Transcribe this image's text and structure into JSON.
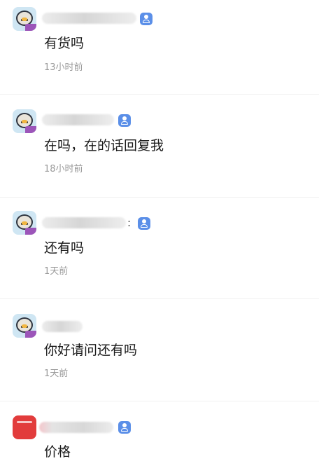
{
  "comments": [
    {
      "message": "有货吗",
      "time": "13小时前",
      "avatar_icon": "penguin-avatar",
      "verified_icon": "verified-user-icon"
    },
    {
      "message": "在吗，在的话回复我",
      "time": "18小时前",
      "avatar_icon": "penguin-avatar",
      "verified_icon": "verified-user-icon"
    },
    {
      "message": "还有吗",
      "time": "1天前",
      "avatar_icon": "penguin-avatar",
      "verified_icon": "verified-user-icon"
    },
    {
      "message": "你好请问还有吗",
      "time": "1天前",
      "avatar_icon": "penguin-avatar",
      "verified_icon": ""
    },
    {
      "message": "价格",
      "time": "",
      "avatar_icon": "red-ticket-avatar",
      "verified_icon": "verified-user-icon"
    }
  ],
  "stray_glyph": ":",
  "colors": {
    "badge": "#5b8fe8",
    "message_text": "#1a1a1a",
    "time_text": "#9a9a9a",
    "divider": "#f0f0f0"
  }
}
